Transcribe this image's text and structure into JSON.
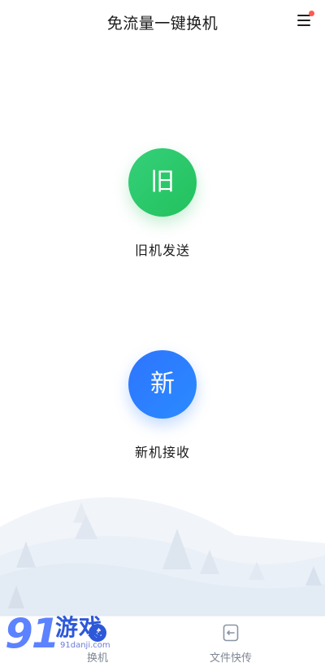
{
  "header": {
    "title": "免流量一键换机"
  },
  "actions": {
    "old": {
      "glyph": "旧",
      "label": "旧机发送"
    },
    "new": {
      "glyph": "新",
      "label": "新机接收"
    }
  },
  "bottom_nav": {
    "left_label": "换机",
    "right_label": "文件快传"
  },
  "watermark": {
    "big": "91",
    "cn": "游戏",
    "sub": "91danji.com"
  },
  "colors": {
    "green": "#24c25f",
    "blue": "#2d7dff",
    "notification_dot": "#ff5a4f",
    "nav_text": "#7f8794"
  }
}
